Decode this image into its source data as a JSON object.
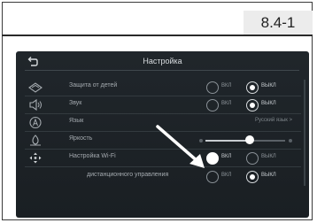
{
  "page": {
    "section_number": "8.4-1"
  },
  "screen": {
    "title": "Настройка",
    "rows": [
      {
        "icon": "child-lock-icon",
        "label": "Защита от детей",
        "options": [
          "ВКЛ",
          "ВЫКЛ"
        ],
        "selected": "ВЫКЛ"
      },
      {
        "icon": "speaker-icon",
        "label": "Звук",
        "options": [
          "ВКЛ",
          "ВЫКЛ"
        ],
        "selected": "ВЫКЛ"
      },
      {
        "icon": "language-icon",
        "label": "Язык",
        "value": "Русский язык >"
      },
      {
        "icon": "brightness-icon",
        "label": "Яркость",
        "level": 0.55
      },
      {
        "icon": "wifi-settings-icon",
        "label": "Настройка Wi-Fi",
        "options": [
          "ВКЛ",
          "ВЫКЛ"
        ],
        "selected": "ВКЛ"
      },
      {
        "label": "дистанционного управления",
        "options": [
          "ВКЛ",
          "ВЫКЛ"
        ],
        "selected": "ВЫКЛ"
      }
    ]
  },
  "colors": {
    "screen_bg": "#1d2226",
    "text": "#a5abb0",
    "selected": "#ffffff"
  }
}
